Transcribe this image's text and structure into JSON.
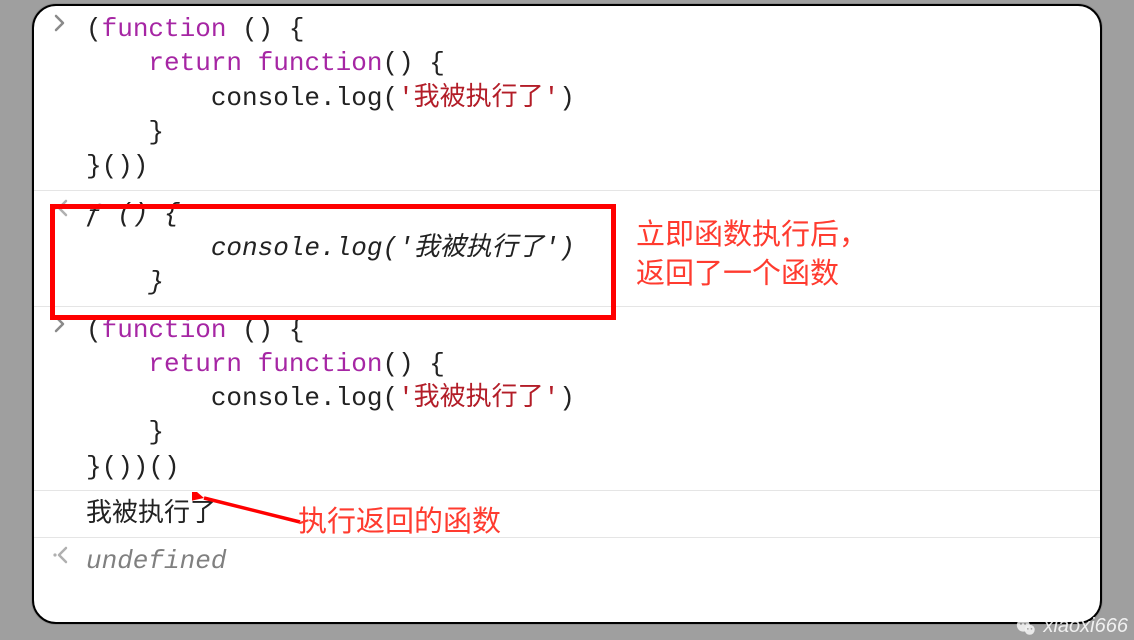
{
  "rows": [
    {
      "kind": "input",
      "lines": [
        [
          [
            "pun",
            "("
          ],
          [
            "kw",
            "function"
          ],
          [
            "pun",
            " () {"
          ]
        ],
        [
          [
            "pun",
            "    "
          ],
          [
            "kw",
            "return"
          ],
          [
            "pun",
            " "
          ],
          [
            "kw",
            "function"
          ],
          [
            "pun",
            "() {"
          ]
        ],
        [
          [
            "pun",
            "        console.log("
          ],
          [
            "str",
            "'我被执行了'"
          ],
          [
            "pun",
            ")"
          ]
        ],
        [
          [
            "pun",
            "    }"
          ]
        ],
        [
          [
            "pun",
            "}())"
          ]
        ]
      ]
    },
    {
      "kind": "output",
      "italic": true,
      "lines": [
        [
          [
            "out",
            "ƒ () {"
          ]
        ],
        [
          [
            "out",
            "        console.log('我被执行了')"
          ]
        ],
        [
          [
            "out",
            "    }"
          ]
        ]
      ]
    },
    {
      "kind": "input",
      "lines": [
        [
          [
            "pun",
            "("
          ],
          [
            "kw",
            "function"
          ],
          [
            "pun",
            " () {"
          ]
        ],
        [
          [
            "pun",
            "    "
          ],
          [
            "kw",
            "return"
          ],
          [
            "pun",
            " "
          ],
          [
            "kw",
            "function"
          ],
          [
            "pun",
            "() {"
          ]
        ],
        [
          [
            "pun",
            "        console.log("
          ],
          [
            "str",
            "'我被执行了'"
          ],
          [
            "pun",
            ")"
          ]
        ],
        [
          [
            "pun",
            "    }"
          ]
        ],
        [
          [
            "pun",
            "}())()"
          ]
        ]
      ]
    },
    {
      "kind": "log",
      "lines": [
        [
          [
            "pun",
            "我被执行了"
          ]
        ]
      ]
    },
    {
      "kind": "output",
      "dim": true,
      "lines": [
        [
          [
            "dim",
            "undefined"
          ]
        ]
      ]
    }
  ],
  "annotations": {
    "right_box_line1": "立即函数执行后，",
    "right_box_line2": "返回了一个函数",
    "arrow_label": "执行返回的函数"
  },
  "watermark": "xiaoxi666"
}
